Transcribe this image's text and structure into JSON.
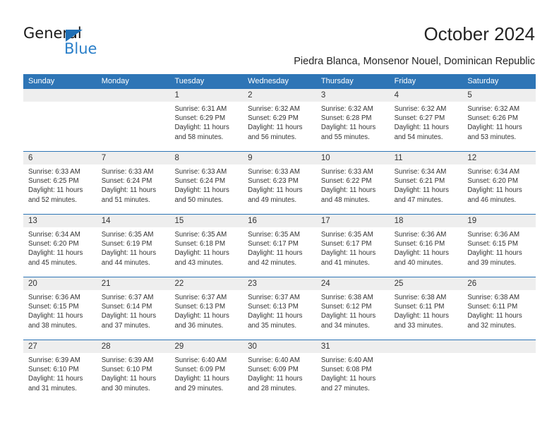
{
  "brand": {
    "name_part1": "General",
    "name_part2": "Blue",
    "logo_icon": "blue-flag-triangle",
    "accent_color": "#2a7fc9"
  },
  "header": {
    "title": "October 2024",
    "location": "Piedra Blanca, Monsenor Nouel, Dominican Republic"
  },
  "theme": {
    "header_blue": "#2e75b6",
    "daynum_band": "#eeeeee",
    "text": "#333333"
  },
  "calendar": {
    "weekdays": [
      "Sunday",
      "Monday",
      "Tuesday",
      "Wednesday",
      "Thursday",
      "Friday",
      "Saturday"
    ],
    "weeks": [
      [
        {
          "day": "",
          "sunrise": "",
          "sunset": "",
          "daylight_line1": "",
          "daylight_line2": ""
        },
        {
          "day": "",
          "sunrise": "",
          "sunset": "",
          "daylight_line1": "",
          "daylight_line2": ""
        },
        {
          "day": "1",
          "sunrise": "Sunrise: 6:31 AM",
          "sunset": "Sunset: 6:29 PM",
          "daylight_line1": "Daylight: 11 hours",
          "daylight_line2": "and 58 minutes."
        },
        {
          "day": "2",
          "sunrise": "Sunrise: 6:32 AM",
          "sunset": "Sunset: 6:29 PM",
          "daylight_line1": "Daylight: 11 hours",
          "daylight_line2": "and 56 minutes."
        },
        {
          "day": "3",
          "sunrise": "Sunrise: 6:32 AM",
          "sunset": "Sunset: 6:28 PM",
          "daylight_line1": "Daylight: 11 hours",
          "daylight_line2": "and 55 minutes."
        },
        {
          "day": "4",
          "sunrise": "Sunrise: 6:32 AM",
          "sunset": "Sunset: 6:27 PM",
          "daylight_line1": "Daylight: 11 hours",
          "daylight_line2": "and 54 minutes."
        },
        {
          "day": "5",
          "sunrise": "Sunrise: 6:32 AM",
          "sunset": "Sunset: 6:26 PM",
          "daylight_line1": "Daylight: 11 hours",
          "daylight_line2": "and 53 minutes."
        }
      ],
      [
        {
          "day": "6",
          "sunrise": "Sunrise: 6:33 AM",
          "sunset": "Sunset: 6:25 PM",
          "daylight_line1": "Daylight: 11 hours",
          "daylight_line2": "and 52 minutes."
        },
        {
          "day": "7",
          "sunrise": "Sunrise: 6:33 AM",
          "sunset": "Sunset: 6:24 PM",
          "daylight_line1": "Daylight: 11 hours",
          "daylight_line2": "and 51 minutes."
        },
        {
          "day": "8",
          "sunrise": "Sunrise: 6:33 AM",
          "sunset": "Sunset: 6:24 PM",
          "daylight_line1": "Daylight: 11 hours",
          "daylight_line2": "and 50 minutes."
        },
        {
          "day": "9",
          "sunrise": "Sunrise: 6:33 AM",
          "sunset": "Sunset: 6:23 PM",
          "daylight_line1": "Daylight: 11 hours",
          "daylight_line2": "and 49 minutes."
        },
        {
          "day": "10",
          "sunrise": "Sunrise: 6:33 AM",
          "sunset": "Sunset: 6:22 PM",
          "daylight_line1": "Daylight: 11 hours",
          "daylight_line2": "and 48 minutes."
        },
        {
          "day": "11",
          "sunrise": "Sunrise: 6:34 AM",
          "sunset": "Sunset: 6:21 PM",
          "daylight_line1": "Daylight: 11 hours",
          "daylight_line2": "and 47 minutes."
        },
        {
          "day": "12",
          "sunrise": "Sunrise: 6:34 AM",
          "sunset": "Sunset: 6:20 PM",
          "daylight_line1": "Daylight: 11 hours",
          "daylight_line2": "and 46 minutes."
        }
      ],
      [
        {
          "day": "13",
          "sunrise": "Sunrise: 6:34 AM",
          "sunset": "Sunset: 6:20 PM",
          "daylight_line1": "Daylight: 11 hours",
          "daylight_line2": "and 45 minutes."
        },
        {
          "day": "14",
          "sunrise": "Sunrise: 6:35 AM",
          "sunset": "Sunset: 6:19 PM",
          "daylight_line1": "Daylight: 11 hours",
          "daylight_line2": "and 44 minutes."
        },
        {
          "day": "15",
          "sunrise": "Sunrise: 6:35 AM",
          "sunset": "Sunset: 6:18 PM",
          "daylight_line1": "Daylight: 11 hours",
          "daylight_line2": "and 43 minutes."
        },
        {
          "day": "16",
          "sunrise": "Sunrise: 6:35 AM",
          "sunset": "Sunset: 6:17 PM",
          "daylight_line1": "Daylight: 11 hours",
          "daylight_line2": "and 42 minutes."
        },
        {
          "day": "17",
          "sunrise": "Sunrise: 6:35 AM",
          "sunset": "Sunset: 6:17 PM",
          "daylight_line1": "Daylight: 11 hours",
          "daylight_line2": "and 41 minutes."
        },
        {
          "day": "18",
          "sunrise": "Sunrise: 6:36 AM",
          "sunset": "Sunset: 6:16 PM",
          "daylight_line1": "Daylight: 11 hours",
          "daylight_line2": "and 40 minutes."
        },
        {
          "day": "19",
          "sunrise": "Sunrise: 6:36 AM",
          "sunset": "Sunset: 6:15 PM",
          "daylight_line1": "Daylight: 11 hours",
          "daylight_line2": "and 39 minutes."
        }
      ],
      [
        {
          "day": "20",
          "sunrise": "Sunrise: 6:36 AM",
          "sunset": "Sunset: 6:15 PM",
          "daylight_line1": "Daylight: 11 hours",
          "daylight_line2": "and 38 minutes."
        },
        {
          "day": "21",
          "sunrise": "Sunrise: 6:37 AM",
          "sunset": "Sunset: 6:14 PM",
          "daylight_line1": "Daylight: 11 hours",
          "daylight_line2": "and 37 minutes."
        },
        {
          "day": "22",
          "sunrise": "Sunrise: 6:37 AM",
          "sunset": "Sunset: 6:13 PM",
          "daylight_line1": "Daylight: 11 hours",
          "daylight_line2": "and 36 minutes."
        },
        {
          "day": "23",
          "sunrise": "Sunrise: 6:37 AM",
          "sunset": "Sunset: 6:13 PM",
          "daylight_line1": "Daylight: 11 hours",
          "daylight_line2": "and 35 minutes."
        },
        {
          "day": "24",
          "sunrise": "Sunrise: 6:38 AM",
          "sunset": "Sunset: 6:12 PM",
          "daylight_line1": "Daylight: 11 hours",
          "daylight_line2": "and 34 minutes."
        },
        {
          "day": "25",
          "sunrise": "Sunrise: 6:38 AM",
          "sunset": "Sunset: 6:11 PM",
          "daylight_line1": "Daylight: 11 hours",
          "daylight_line2": "and 33 minutes."
        },
        {
          "day": "26",
          "sunrise": "Sunrise: 6:38 AM",
          "sunset": "Sunset: 6:11 PM",
          "daylight_line1": "Daylight: 11 hours",
          "daylight_line2": "and 32 minutes."
        }
      ],
      [
        {
          "day": "27",
          "sunrise": "Sunrise: 6:39 AM",
          "sunset": "Sunset: 6:10 PM",
          "daylight_line1": "Daylight: 11 hours",
          "daylight_line2": "and 31 minutes."
        },
        {
          "day": "28",
          "sunrise": "Sunrise: 6:39 AM",
          "sunset": "Sunset: 6:10 PM",
          "daylight_line1": "Daylight: 11 hours",
          "daylight_line2": "and 30 minutes."
        },
        {
          "day": "29",
          "sunrise": "Sunrise: 6:40 AM",
          "sunset": "Sunset: 6:09 PM",
          "daylight_line1": "Daylight: 11 hours",
          "daylight_line2": "and 29 minutes."
        },
        {
          "day": "30",
          "sunrise": "Sunrise: 6:40 AM",
          "sunset": "Sunset: 6:09 PM",
          "daylight_line1": "Daylight: 11 hours",
          "daylight_line2": "and 28 minutes."
        },
        {
          "day": "31",
          "sunrise": "Sunrise: 6:40 AM",
          "sunset": "Sunset: 6:08 PM",
          "daylight_line1": "Daylight: 11 hours",
          "daylight_line2": "and 27 minutes."
        },
        {
          "day": "",
          "sunrise": "",
          "sunset": "",
          "daylight_line1": "",
          "daylight_line2": ""
        },
        {
          "day": "",
          "sunrise": "",
          "sunset": "",
          "daylight_line1": "",
          "daylight_line2": ""
        }
      ]
    ]
  }
}
